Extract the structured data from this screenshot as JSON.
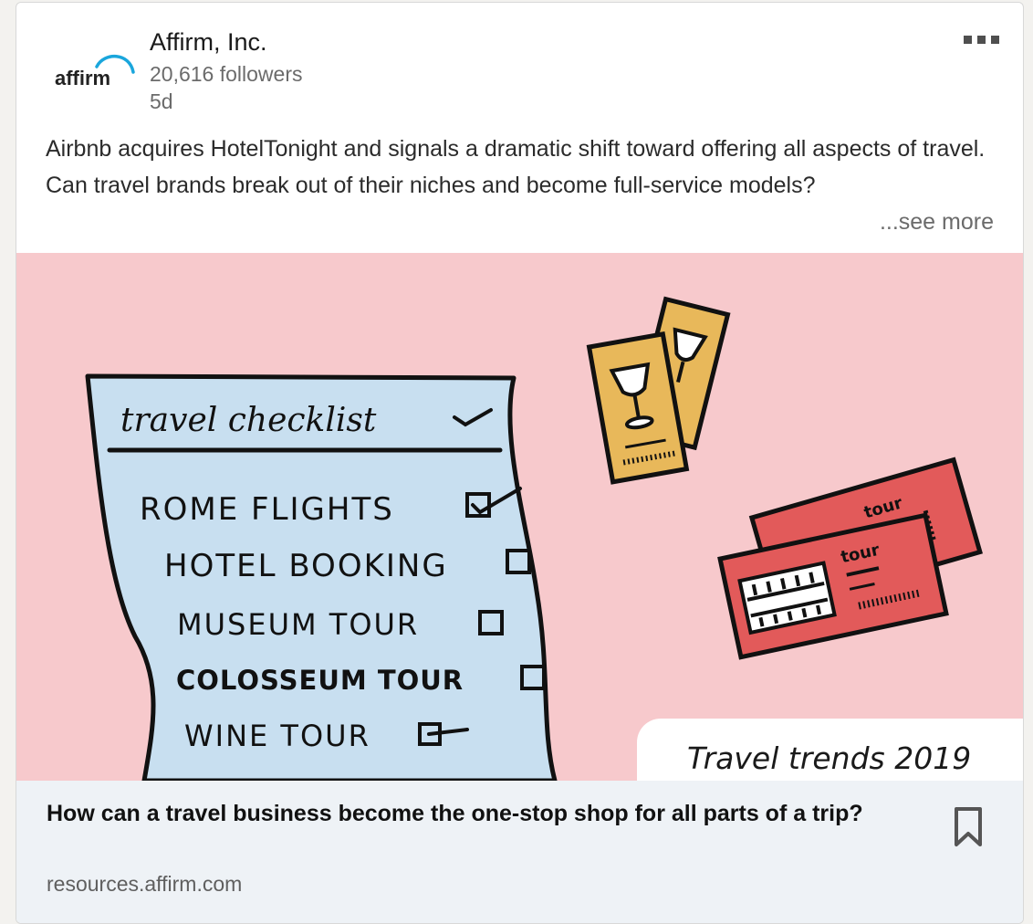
{
  "post": {
    "company_name": "Affirm, Inc.",
    "logo_text": "affirm",
    "followers": "20,616 followers",
    "age": "5d",
    "body": "Airbnb acquires HotelTonight and signals a dramatic shift toward offering all aspects of travel. Can travel brands break out of their niches and become full-service models?",
    "see_more": "...see more",
    "more_icon": "ellipsis-icon"
  },
  "image": {
    "checklist_title": "travel checklist",
    "items": [
      "ROME FLIGHTS",
      "HOTEL BOOKING",
      "MUSEUM TOUR",
      "COLOSSEUM TOUR",
      "WINE TOUR"
    ],
    "ticket_label_1": "tour",
    "ticket_label_2": "tour",
    "badge": "Travel trends 2019",
    "colors": {
      "background": "#f7c9cc",
      "paper": "#c8dff0",
      "wine_ticket": "#e8b85a",
      "tour_ticket": "#e25a5a"
    }
  },
  "link": {
    "headline": "How can a travel business become the one-stop shop for all parts of a trip?",
    "source": "resources.affirm.com",
    "bookmark_icon": "bookmark-icon"
  }
}
